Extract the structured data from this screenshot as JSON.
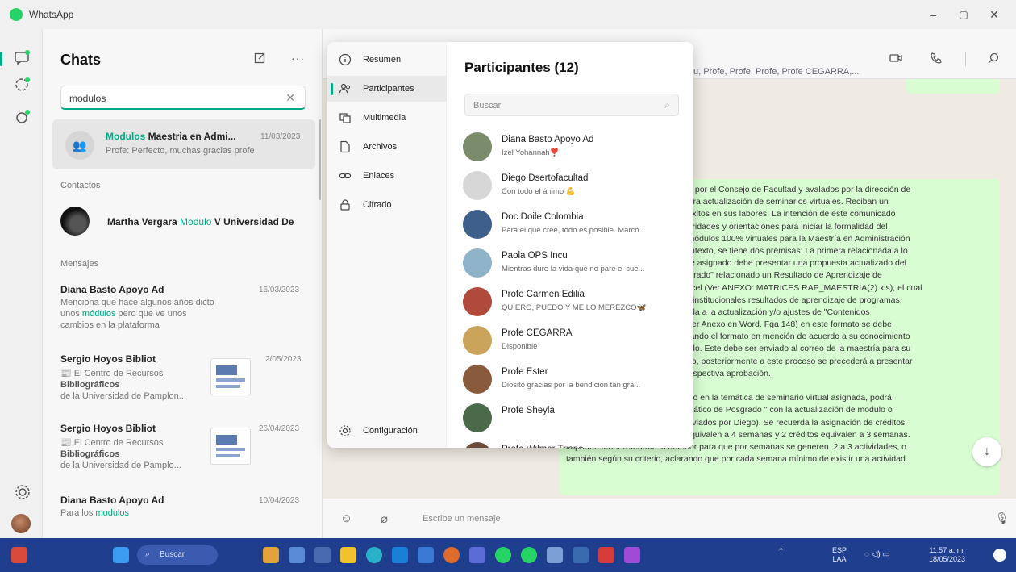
{
  "window": {
    "title": "WhatsApp",
    "controls": [
      "–",
      "▢",
      "✕"
    ]
  },
  "chatlist": {
    "title": "Chats",
    "search_value": "modulos",
    "selected": {
      "highlight": "Modulos",
      "name": " Maestria en Admi...",
      "date": "11/03/2023",
      "preview": "Profe: Perfecto, muchas gracias profe"
    },
    "contacts_label": "Contactos",
    "contact": {
      "pre": "Martha Vergara ",
      "highlight": "Modulo",
      "post": " V Universidad De"
    },
    "messages_label": "Mensajes",
    "messages": [
      {
        "name": "Diana Basto Apoyo Ad",
        "date": "16/03/2023",
        "lines": [
          "Menciona que hace algunos años dicto",
          "unos |módulos| pero que ve unos",
          "cambios en la plataforma"
        ]
      },
      {
        "name": "Sergio Hoyos Bibliot",
        "date": "2/05/2023",
        "lines": [
          "📰 El Centro de Recursos",
          "Bibliográficos",
          "de la Universidad de Pamplon..."
        ]
      },
      {
        "name": "Sergio Hoyos Bibliot",
        "date": "26/04/2023",
        "lines": [
          "📰 El Centro de Recursos",
          "Bibliográficos",
          "de la Universidad de Pamplo..."
        ]
      },
      {
        "name": "Diana Basto Apoyo Ad",
        "date": "10/04/2023",
        "lines": [
          "Para los |modulos|"
        ]
      }
    ]
  },
  "header": {
    "members": "u, Profe, Profe, Profe, Profe CEGARRA,..."
  },
  "popup": {
    "nav": [
      {
        "label": "Resumen",
        "icon": "info-icon"
      },
      {
        "label": "Participantes",
        "icon": "people-icon"
      },
      {
        "label": "Multimedia",
        "icon": "media-icon"
      },
      {
        "label": "Archivos",
        "icon": "file-icon"
      },
      {
        "label": "Enlaces",
        "icon": "link-icon"
      },
      {
        "label": "Cifrado",
        "icon": "lock-icon"
      }
    ],
    "settings_label": "Configuración",
    "title": "Participantes (12)",
    "search_placeholder": "Buscar",
    "participants": [
      {
        "name": "Diana Basto Apoyo Ad",
        "status": "Izel Yohannah❣️",
        "color": "#7a8c6a"
      },
      {
        "name": "Diego Dsertofacultad",
        "status": "Con todo el ánimo 💪",
        "color": "#d7d7d7"
      },
      {
        "name": "Doc Doile Colombia",
        "status": "Para el que cree, todo es posible. Marco...",
        "color": "#3d5f8a"
      },
      {
        "name": "Paola OPS Incu",
        "status": "Mientras dure la vida que no pare el cue...",
        "color": "#8fb3c9"
      },
      {
        "name": "Profe Carmen Edilia",
        "status": "QUIERO, PUEDO Y ME LO MEREZCO🦋",
        "color": "#b04a3c"
      },
      {
        "name": "Profe CEGARRA",
        "status": "Disponible",
        "color": "#c9a45a"
      },
      {
        "name": "Profe Ester",
        "status": "Diosito gracias por la bendicion tan gra...",
        "color": "#8a5a3c"
      },
      {
        "name": "Profe Sheyla",
        "status": "",
        "color": "#4a6a4a"
      },
      {
        "name": "Profe Wilmer Triana",
        "status": "",
        "color": "#6a4a3a"
      }
    ]
  },
  "conversation": {
    "message_lines": [
      "                                              ados por el Consejo de Facultad y avalados por la dirección de",
      "                                              n, para actualización de seminarios virtuales. Reciban un",
      "                                              les éxitos en sus labores. La intención de este comunicado",
      "                                              a claridades y orientaciones para iniciar la formalidad del",
      "                                              los módulos 100% virtuales para la Maestría en Administración",
      "                                              e contexto, se tiene dos premisas: La primera relacionada a lo",
      "                                              cente asignado debe presentar una propuesta actualizado del",
      "                                              Posgrado\" relacionado un Resultado de Aprendizaje de",
      "                                              n Excel (Ver ANEXO: MATRICES RAP_MAESTRIA(2).xls), el cual",
      "                                              ntos institucionales resultados de aprendizaje de programas,",
      "                                              focada a la actualización y/o ajustes de \"Contenidos",
      "                                              s\" (Ver Anexo en Word. Fga 148) en este formato se debe",
      "                                              enciando el formato en mención de acuerdo a su conocimiento",
      "                                              ignado. Este debe ser enviado al correo de la maestría para su",
      "                                              l caso, posteriormente a este proceso se precederá a presentar",
      "                                              su respectiva aprobación.",
      "",
      "                                              xperto en la temática de seminario virtual asignada, podrá",
      "                                              gramático de Posgrado \" con la actualización de modulo o",
      "seminario asignado (Formatos enviados por Diego). Se recuerda la asignación de créditos",
      "vs tiempo. 3 créditos en tiempo equivalen a 4 semanas y 2 créditos equivalen a 3 semanas.",
      "importen tener referente lo anterior para que por semanas se generen  2 a 3 actividades, o",
      "también según su criterio, aclarando que por cada semana mínimo de existir una actividad."
    ],
    "composer_placeholder": "Escribe un mensaje"
  },
  "taskbar": {
    "search_label": "Buscar",
    "lang": [
      "ESP",
      "LAA"
    ],
    "time": "11:57 a. m.",
    "date": "18/05/2023"
  }
}
